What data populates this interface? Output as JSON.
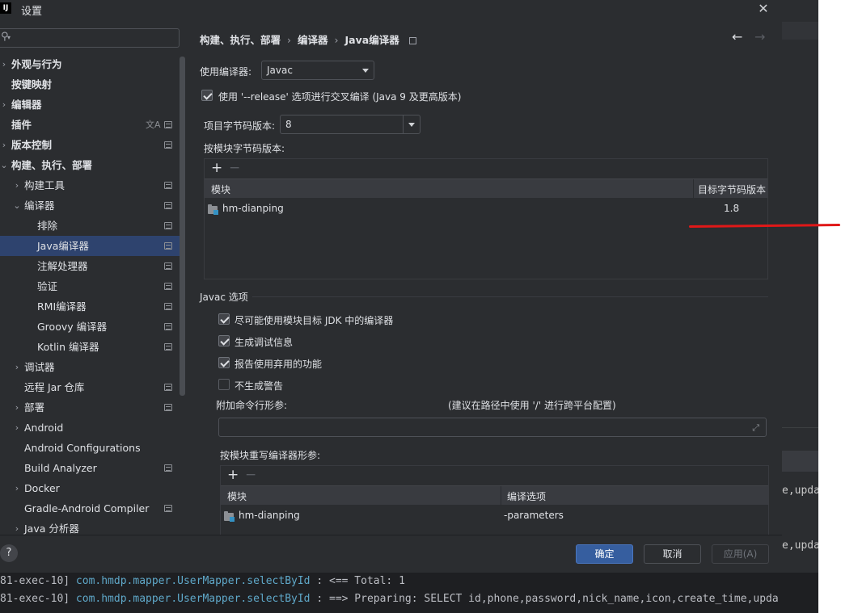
{
  "window": {
    "title": "设置",
    "logo": "IJ"
  },
  "sidebar": {
    "items": [
      {
        "label": "外观与行为",
        "bold": true,
        "chevron": "›",
        "level": 0
      },
      {
        "label": "按键映射",
        "bold": true,
        "chevron": "",
        "level": 0
      },
      {
        "label": "编辑器",
        "bold": true,
        "chevron": "›",
        "level": 0
      },
      {
        "label": "插件",
        "bold": true,
        "chevron": "",
        "level": 0,
        "translate_icon": "文A",
        "page_icon": true
      },
      {
        "label": "版本控制",
        "bold": true,
        "chevron": "›",
        "level": 0,
        "page_icon": true
      },
      {
        "label": "构建、执行、部署",
        "bold": true,
        "chevron": "⌄",
        "level": 0
      },
      {
        "label": "构建工具",
        "chevron": "›",
        "level": 1,
        "page_icon": true
      },
      {
        "label": "编译器",
        "chevron": "⌄",
        "level": 1,
        "page_icon": true
      },
      {
        "label": "排除",
        "chevron": "",
        "level": 2,
        "page_icon": true
      },
      {
        "label": "Java编译器",
        "chevron": "",
        "level": 2,
        "page_icon": true,
        "selected": true
      },
      {
        "label": "注解处理器",
        "chevron": "",
        "level": 2,
        "page_icon": true
      },
      {
        "label": "验证",
        "chevron": "",
        "level": 2,
        "page_icon": true
      },
      {
        "label": "RMI编译器",
        "chevron": "",
        "level": 2,
        "page_icon": true
      },
      {
        "label": "Groovy 编译器",
        "chevron": "",
        "level": 2,
        "page_icon": true
      },
      {
        "label": "Kotlin 编译器",
        "chevron": "",
        "level": 2,
        "page_icon": true
      },
      {
        "label": "调试器",
        "chevron": "›",
        "level": 1
      },
      {
        "label": "远程 Jar 仓库",
        "chevron": "",
        "level": 1,
        "page_icon": true
      },
      {
        "label": "部署",
        "chevron": "›",
        "level": 1,
        "page_icon": true
      },
      {
        "label": "Android",
        "chevron": "›",
        "level": 1
      },
      {
        "label": "Android Configurations",
        "chevron": "",
        "level": 1
      },
      {
        "label": "Build Analyzer",
        "chevron": "",
        "level": 1,
        "page_icon": true
      },
      {
        "label": "Docker",
        "chevron": "›",
        "level": 1
      },
      {
        "label": "Gradle-Android Compiler",
        "chevron": "",
        "level": 1,
        "page_icon": true
      },
      {
        "label": "Java 分析器",
        "chevron": "›",
        "level": 1
      }
    ]
  },
  "breadcrumb": {
    "parts": [
      "构建、执行、部署",
      "编译器",
      "Java编译器"
    ],
    "sep": "›"
  },
  "compiler": {
    "label": "使用编译器:",
    "value": "Javac"
  },
  "release_option": {
    "label": "使用 '--release' 选项进行交叉编译 (Java 9 及更高版本)",
    "checked": true
  },
  "bytecode": {
    "label": "项目字节码版本:",
    "value": "8"
  },
  "per_module": {
    "label": "按模块字节码版本:",
    "columns": [
      "模块",
      "目标字节码版本"
    ],
    "rows": [
      {
        "module": "hm-dianping",
        "version": "1.8"
      }
    ]
  },
  "javac": {
    "section": "Javac 选项",
    "options": [
      {
        "label": "尽可能使用模块目标 JDK 中的编译器",
        "checked": true
      },
      {
        "label": "生成调试信息",
        "checked": true
      },
      {
        "label": "报告使用弃用的功能",
        "checked": true
      },
      {
        "label": "不生成警告",
        "checked": false
      }
    ],
    "cmd_label": "附加命令行形参:",
    "cmd_hint": "(建议在路径中使用 '/' 进行跨平台配置)",
    "cmd_value": ""
  },
  "override": {
    "label": "按模块重写编译器形参:",
    "columns": [
      "模块",
      "编译选项"
    ],
    "rows": [
      {
        "module": "hm-dianping",
        "options": "-parameters"
      }
    ]
  },
  "footer": {
    "help": "?",
    "ok": "确定",
    "cancel": "取消",
    "apply": "应用(A)"
  },
  "console": {
    "lines": [
      {
        "thread": "81-exec-10]",
        "cls": "com.hmdp.mapper.UserMapper.selectById",
        "msg": "  : <==      Total: 1"
      },
      {
        "thread": "81-exec-10]",
        "cls": "com.hmdp.mapper.UserMapper.selectById",
        "msg": "  : ==>  Preparing: SELECT id,phone,password,nick_name,icon,create_time,upda"
      }
    ]
  },
  "ide_right": {
    "frag1": "e,upda",
    "frag2": "e,upda"
  }
}
